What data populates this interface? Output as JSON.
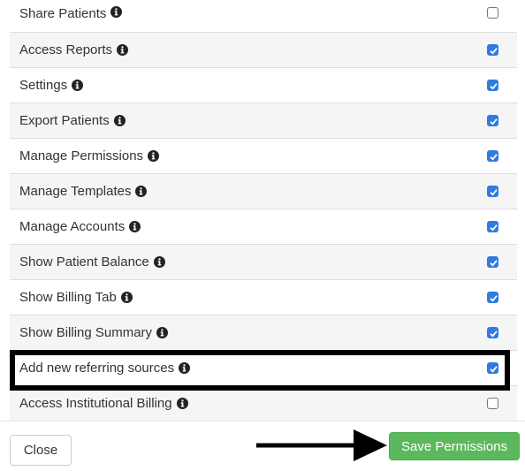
{
  "permissions": [
    {
      "label": "Share Patients",
      "checked": false
    },
    {
      "label": "Access Reports",
      "checked": true
    },
    {
      "label": "Settings",
      "checked": true
    },
    {
      "label": "Export Patients",
      "checked": true
    },
    {
      "label": "Manage Permissions",
      "checked": true
    },
    {
      "label": "Manage Templates",
      "checked": true
    },
    {
      "label": "Manage Accounts",
      "checked": true
    },
    {
      "label": "Show Patient Balance",
      "checked": true
    },
    {
      "label": "Show Billing Tab",
      "checked": true
    },
    {
      "label": "Show Billing Summary",
      "checked": true
    },
    {
      "label": "Add new referring sources",
      "checked": true,
      "highlighted": true
    },
    {
      "label": "Access Institutional Billing",
      "checked": false
    }
  ],
  "footer": {
    "close_label": "Close",
    "save_label": "Save Permissions"
  },
  "icons": {
    "info": "info-circle-icon",
    "arrow": "arrow-right-icon"
  },
  "colors": {
    "checkbox_checked": "#2f7be0",
    "save_button": "#5cb85c",
    "highlight_border": "#000000",
    "row_stripe": "#f5f5f5"
  }
}
